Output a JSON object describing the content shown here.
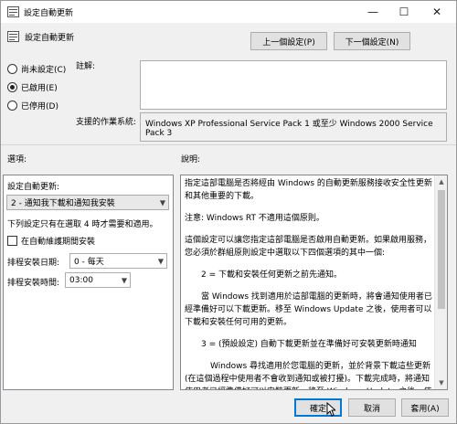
{
  "window": {
    "title": "設定自動更新",
    "minimize": "—",
    "maximize": "☐",
    "close": "✕"
  },
  "header": {
    "title": "設定自動更新",
    "prev_setting": "上一個設定(P)",
    "next_setting": "下一個設定(N)"
  },
  "state": {
    "options": [
      {
        "label": "尚未設定(C)",
        "checked": false
      },
      {
        "label": "已啟用(E)",
        "checked": true
      },
      {
        "label": "已停用(D)",
        "checked": false
      }
    ]
  },
  "comment": {
    "label": "註解:",
    "value": ""
  },
  "supported": {
    "label": "支援的作業系統:",
    "value": "Windows XP Professional Service Pack 1 或至少 Windows 2000 Service Pack 3"
  },
  "sections": {
    "options_label": "選項:",
    "help_label": "說明:"
  },
  "options_panel": {
    "config_label": "設定自動更新:",
    "config_value": "2 - 通知我下載和通知我安裝",
    "note": "下列設定只有在選取 4 時才需要和適用。",
    "maintenance_label": "在自動維護期間安裝",
    "day_label": "排程安裝日期:",
    "day_value": "0 - 每天",
    "time_label": "排程安裝時間:",
    "time_value": "03:00"
  },
  "help_panel": {
    "paragraphs": [
      "指定這部電腦是否將經由 Windows 的自動更新服務接收安全性更新和其他重要的下載。",
      "注意: Windows RT 不適用這個原則。",
      "這個設定可以讓您指定這部電腦是否啟用自動更新。如果啟用服務，您必須於群組原則設定中選取以下四個選項的其中一個:",
      "2 = 下載和安裝任何更新之前先通知。",
      "當 Windows 找到適用於這部電腦的更新時，將會通知使用者已經準備好可以下載更新。移至 Windows Update 之後，使用者可以下載和安裝任何可用的更新。",
      "3 = (預設設定) 自動下載更新並在準備好可安裝更新時通知",
      "Windows 尋找適用於您電腦的更新，並於背景下載這些更新 (在這個過程中使用者不會收到通知或被打擾)。下載完成時，將通知使用者已經準備好可以安裝更新。移至 Windows Update 之後，使用者就可以安"
    ]
  },
  "footer": {
    "ok": "確定",
    "cancel": "取消",
    "apply": "套用(A)"
  }
}
